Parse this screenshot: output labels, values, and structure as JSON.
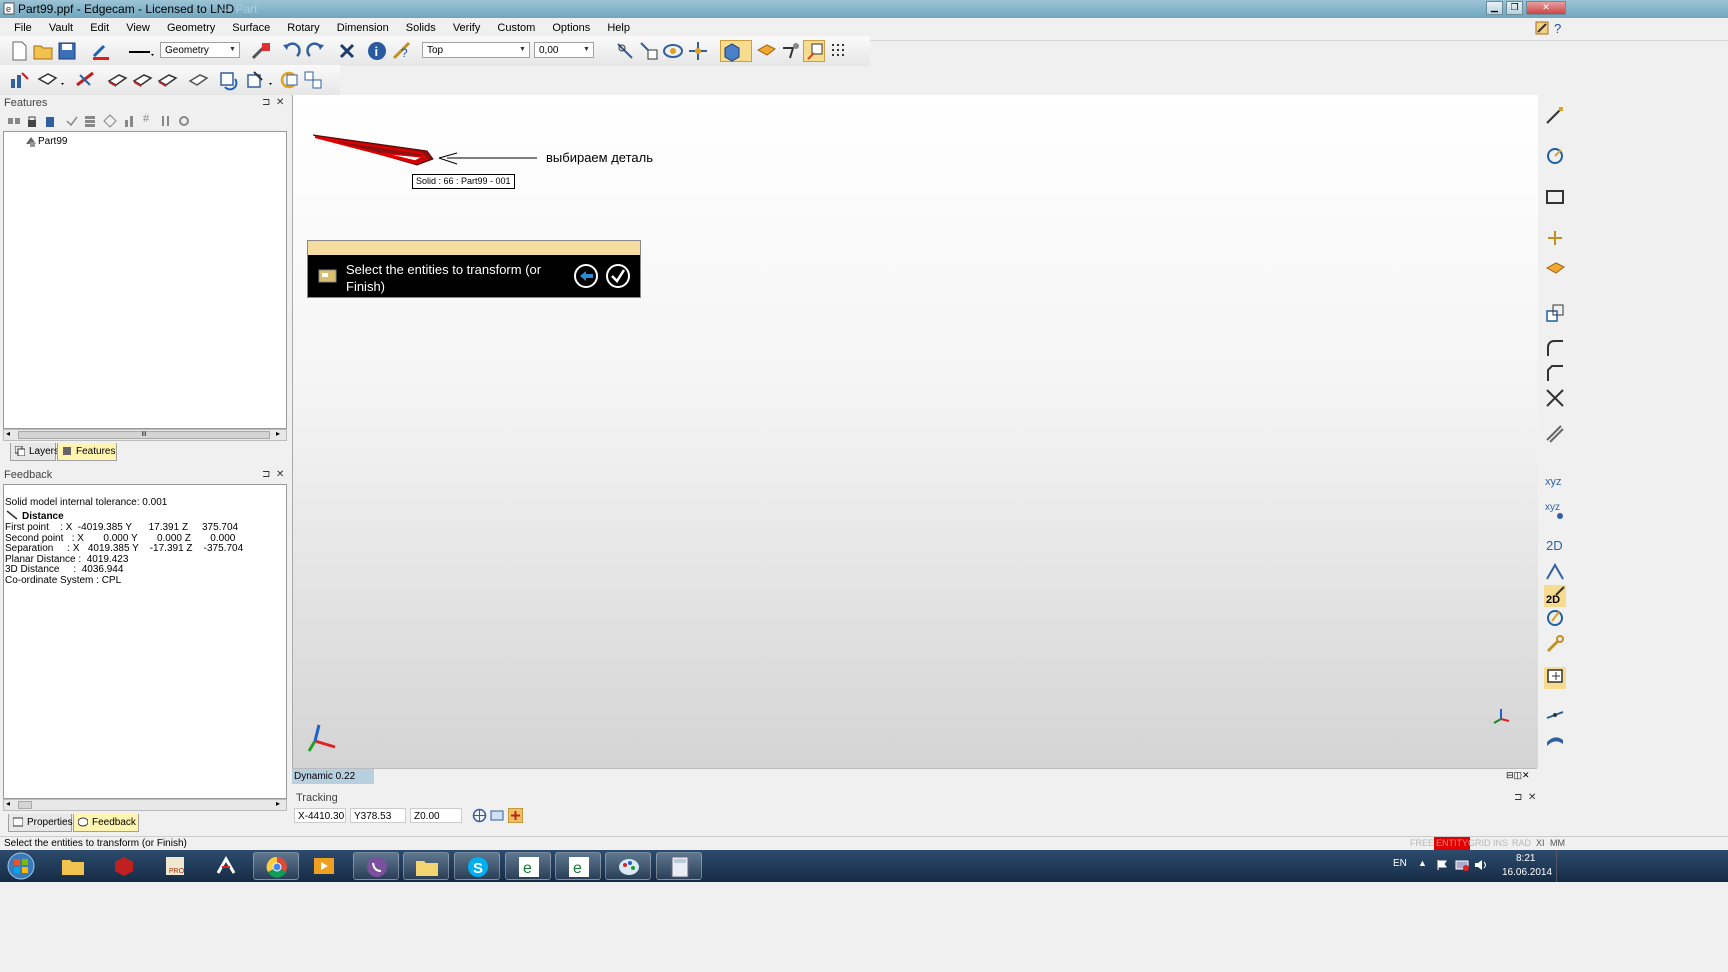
{
  "window": {
    "title": "Part99.ppf - Edgecam - Licensed to LND",
    "title_ghost": "— Part"
  },
  "menu": [
    "File",
    "Vault",
    "Edit",
    "View",
    "Geometry",
    "Surface",
    "Rotary",
    "Dimension",
    "Solids",
    "Verify",
    "Custom",
    "Options",
    "Help"
  ],
  "toolbar": {
    "layer_combo": "Geometry",
    "view_combo": "Top",
    "value_combo": "0,00"
  },
  "features_panel": {
    "title": "Features",
    "tree_root": "Part99",
    "scroll_grip": "III",
    "tabs": [
      "Layers",
      "Features"
    ]
  },
  "feedback_panel": {
    "title": "Feedback",
    "line_tolerance": "Solid model internal tolerance: 0.001",
    "distance_heading": "Distance",
    "first_point": "First point    : X  -4019.385 Y      17.391 Z     375.704",
    "second_point": "Second point   : X       0.000 Y       0.000 Z       0.000",
    "separation": "Separation     : X   4019.385 Y    -17.391 Z    -375.704",
    "planar": "Planar Distance :  4019.423",
    "distance3d": "3D Distance     :  4036.944",
    "coord_system": "Co-ordinate System : CPL",
    "tabs": [
      "Properties",
      "Feedback"
    ]
  },
  "viewport": {
    "tooltip": "Solid : 66 : Part99 - 001",
    "annotation": "выбираем деталь",
    "prompt_message": "Select the entities to transform (or Finish)",
    "dynamic_label": "Dynamic 0.22"
  },
  "tracking": {
    "title": "Tracking",
    "x": "X-4410.30",
    "y": "Y378.53",
    "z": "Z0.00"
  },
  "statusbar": {
    "message": "Select the entities to transform (or Finish)",
    "indicators": [
      "FREE",
      "ENTITY",
      "GRID",
      "INS",
      "RAD",
      "XI",
      "MM"
    ]
  },
  "tray": {
    "lang": "EN",
    "time": "8:21",
    "date": "16.06.2014"
  },
  "colors": {
    "accent_yellow": "#f5dca0",
    "entity_red": "#e00000",
    "part_red": "#8b1010",
    "taskbar": "#1e3a58"
  }
}
